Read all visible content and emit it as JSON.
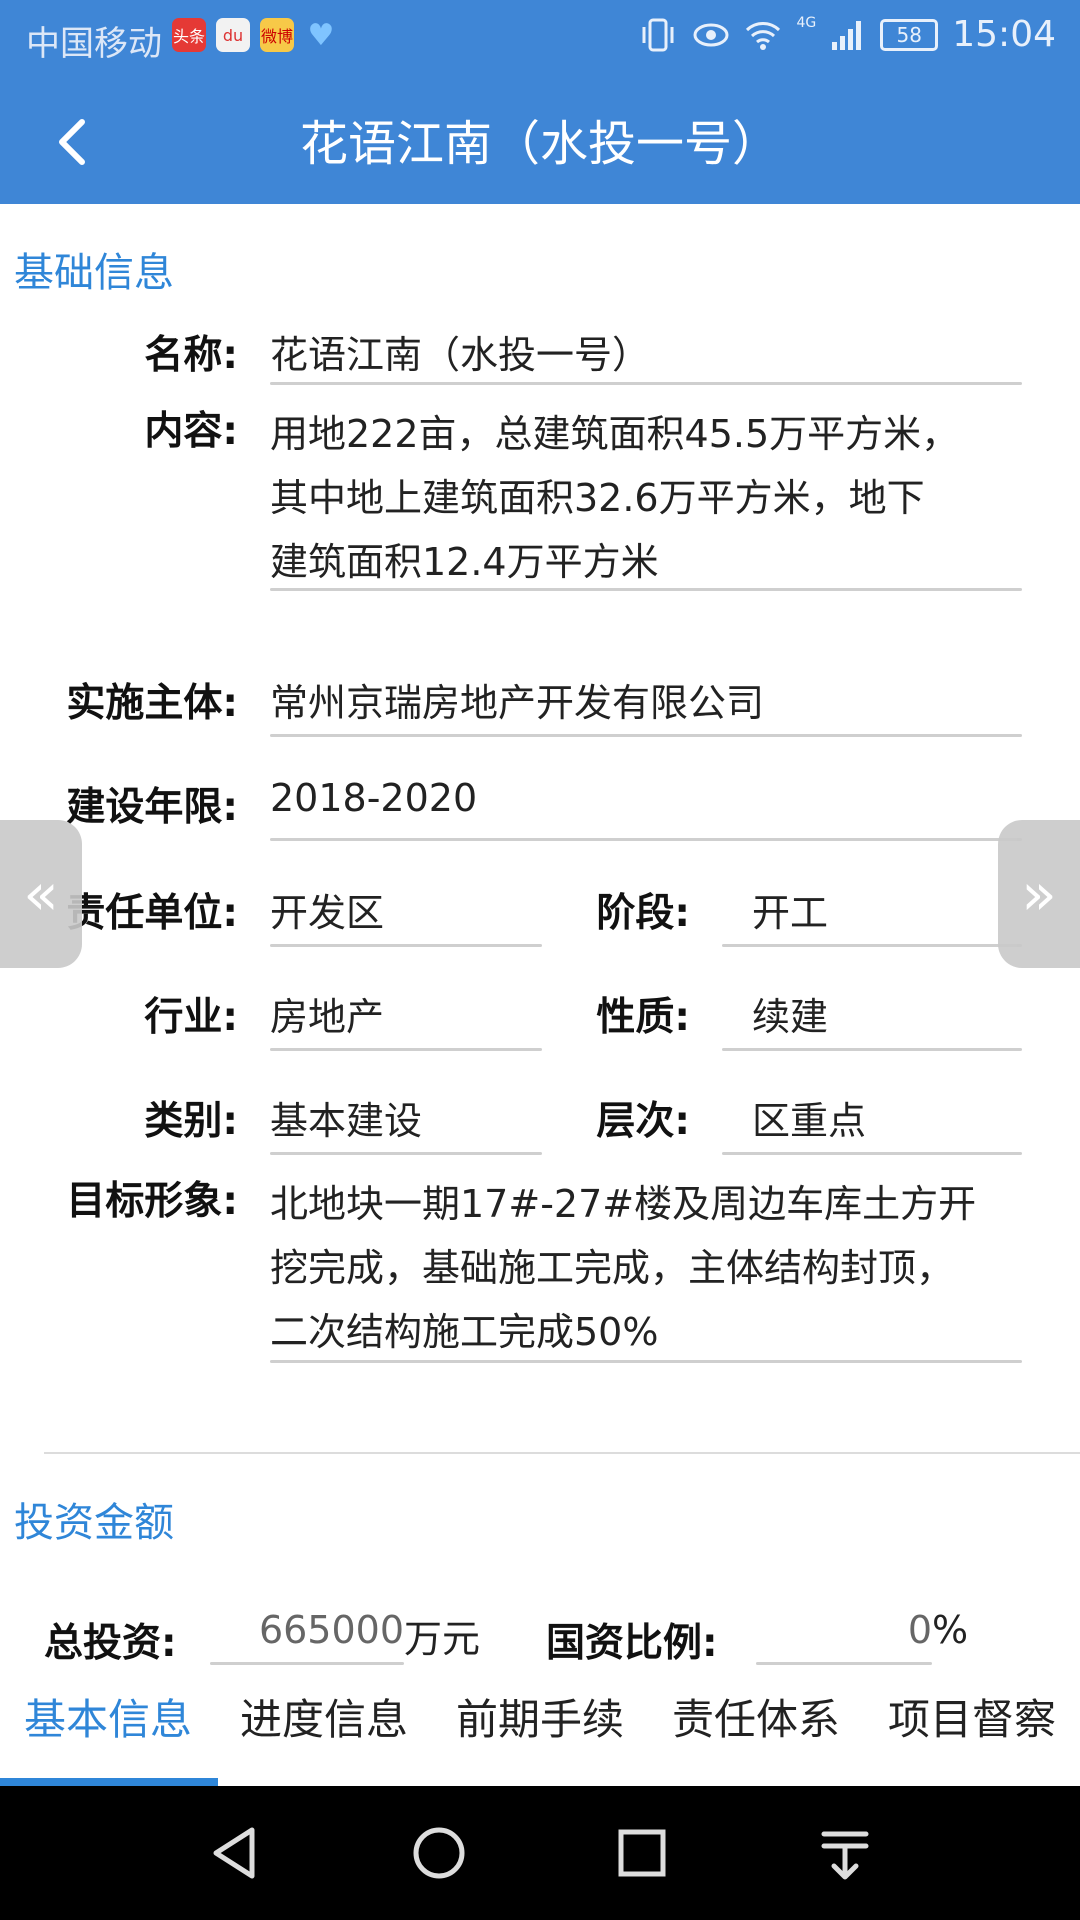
{
  "status_bar": {
    "carrier": "中国移动",
    "app_badges": [
      "头条",
      "du",
      "微博",
      "♥"
    ],
    "network": "4G",
    "battery": "58",
    "time": "15:04"
  },
  "header": {
    "title": "花语江南（水投一号）"
  },
  "basic_info": {
    "section_title": "基础信息",
    "name_label": "名称:",
    "name_value": "花语江南（水投一号）",
    "content_label": "内容:",
    "content_value": "用地222亩，总建筑面积45.5万平方米，其中地上建筑面积32.6万平方米，地下建筑面积12.4万平方米",
    "entity_label": "实施主体:",
    "entity_value": "常州京瑞房地产开发有限公司",
    "period_label": "建设年限:",
    "period_value": "2018-2020",
    "resp_label": "责任单位:",
    "resp_value": "开发区",
    "stage_label": "阶段:",
    "stage_value": "开工",
    "industry_label": "行业:",
    "industry_value": "房地产",
    "nature_label": "性质:",
    "nature_value": "续建",
    "category_label": "类别:",
    "category_value": "基本建设",
    "level_label": "层次:",
    "level_value": "区重点",
    "target_label": "目标形象:",
    "target_value": "北地块一期17#-27#楼及周边车库土方开挖完成，基础施工完成，主体结构封顶，二次结构施工完成50%"
  },
  "investment": {
    "section_title": "投资金额",
    "total_label": "总投资:",
    "total_value": "665000",
    "total_unit": "万元",
    "state_ratio_label": "国资比例:",
    "state_ratio_value": "0",
    "state_ratio_unit": "%"
  },
  "side_nav": {
    "prev": "«",
    "next": "»"
  },
  "tabs": [
    {
      "label": "基本信息",
      "active": true
    },
    {
      "label": "进度信息",
      "active": false
    },
    {
      "label": "前期手续",
      "active": false
    },
    {
      "label": "责任体系",
      "active": false
    },
    {
      "label": "项目督察",
      "active": false
    }
  ],
  "colors": {
    "primary": "#3f86d6",
    "accent_text": "#2f86d8"
  }
}
